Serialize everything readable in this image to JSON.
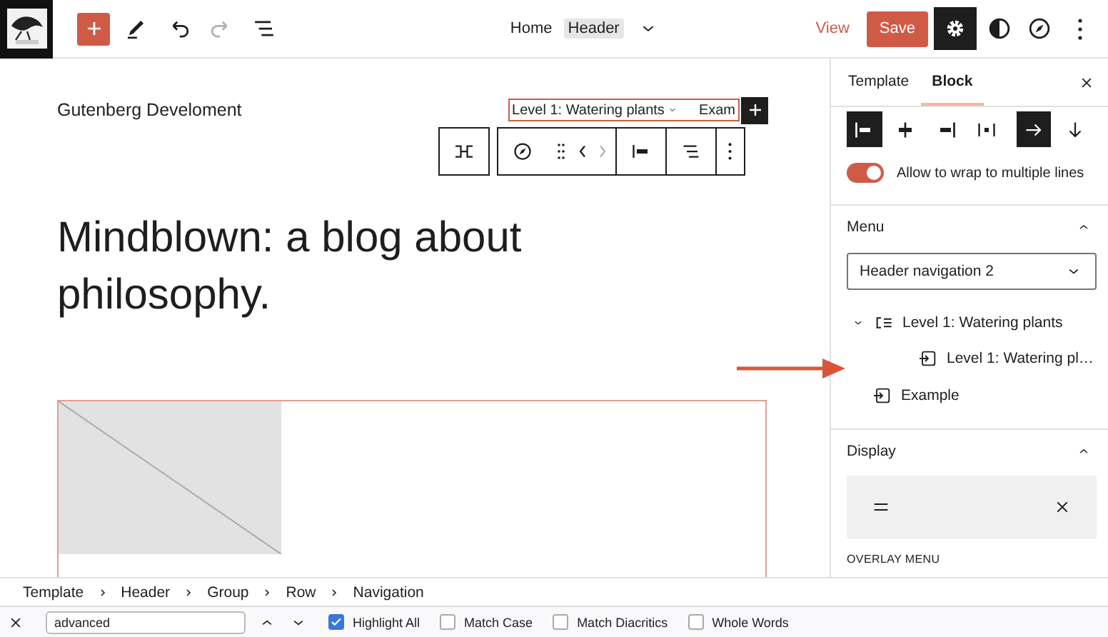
{
  "topbar": {
    "document": [
      {
        "label": "Home",
        "selected": false
      },
      {
        "label": "Header",
        "selected": true
      }
    ],
    "view": "View",
    "save": "Save",
    "settings_open": true
  },
  "canvas": {
    "site_title": "Gutenberg Develoment",
    "nav_items": [
      {
        "label": "Level 1: Watering plants",
        "kind": "submenu"
      },
      {
        "label": "Exam",
        "kind": "link"
      }
    ],
    "heading": "Mindblown: a blog about philosophy."
  },
  "sidebar": {
    "tabs": [
      {
        "label": "Template",
        "selected": false
      },
      {
        "label": "Block",
        "selected": true
      }
    ],
    "justify": [
      {
        "kind": "left",
        "selected": true
      },
      {
        "kind": "center",
        "selected": false
      },
      {
        "kind": "right",
        "selected": false
      },
      {
        "kind": "between",
        "selected": false
      }
    ],
    "orientation": [
      {
        "kind": "horizontal",
        "selected": true
      },
      {
        "kind": "vertical",
        "selected": false
      }
    ],
    "wrap": {
      "label": "Allow to wrap to multiple lines",
      "on": true
    },
    "menu": {
      "title": "Menu",
      "expanded": true,
      "select": "Header navigation 2",
      "items": [
        {
          "label": "Level 1: Watering plants",
          "kind": "submenu",
          "expanded": true,
          "children": [
            {
              "label": "Level 1: Watering pl…",
              "kind": "link"
            }
          ]
        },
        {
          "label": "Example",
          "kind": "link"
        }
      ]
    },
    "display": {
      "title": "Display",
      "expanded": true,
      "overlay_label": "OVERLAY MENU"
    }
  },
  "breadcrumbs": [
    "Template",
    "Header",
    "Group",
    "Row",
    "Navigation"
  ],
  "findbar": {
    "value": "advanced",
    "options": [
      {
        "label": "Highlight All",
        "checked": true
      },
      {
        "label": "Match Case",
        "checked": false
      },
      {
        "label": "Match Diacritics",
        "checked": false
      },
      {
        "label": "Whole Words",
        "checked": false
      }
    ]
  }
}
